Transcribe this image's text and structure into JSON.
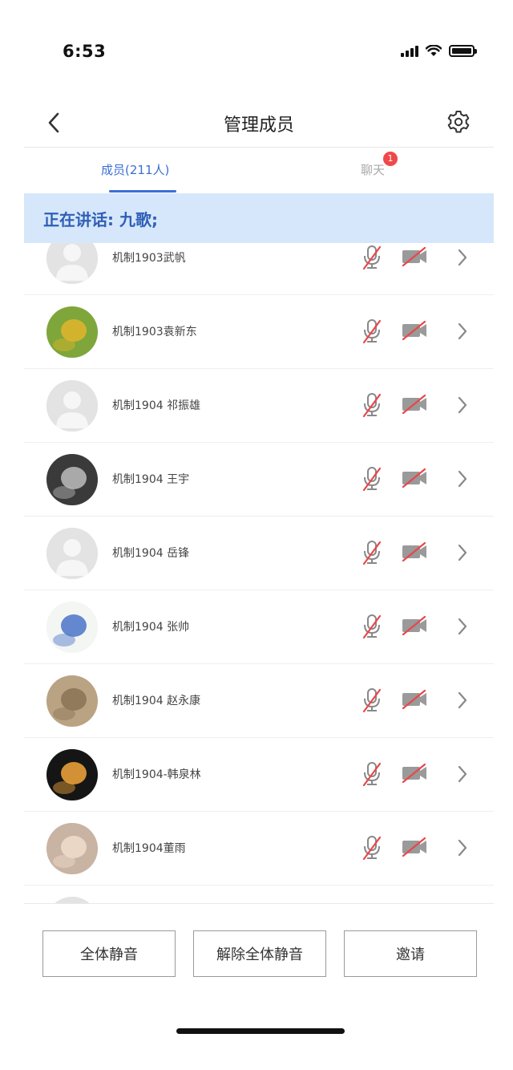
{
  "status_bar": {
    "time": "6:53"
  },
  "nav": {
    "title": "管理成员"
  },
  "tabs": {
    "members_label": "成员(211人)",
    "chat_label": "聊天",
    "chat_badge": "1"
  },
  "speaking": {
    "text": "正在讲话: 九歌;"
  },
  "members": [
    {
      "name": "机制1903武帆",
      "avatar": "default-avatar"
    },
    {
      "name": "机制1903袁新东",
      "avatar": "photo-avatar"
    },
    {
      "name": "机制1904  祁振雄",
      "avatar": "default-avatar"
    },
    {
      "name": "机制1904 王宇",
      "avatar": "photo-avatar"
    },
    {
      "name": "机制1904 岳锋",
      "avatar": "default-avatar"
    },
    {
      "name": "机制1904 张帅",
      "avatar": "photo-avatar"
    },
    {
      "name": "机制1904 赵永康",
      "avatar": "photo-avatar"
    },
    {
      "name": "机制1904-韩泉林",
      "avatar": "photo-avatar"
    },
    {
      "name": "机制1904董雨",
      "avatar": "photo-avatar"
    }
  ],
  "actions": {
    "mute_all": "全体静音",
    "unmute_all": "解除全体静音",
    "invite": "邀请"
  },
  "colors": {
    "accent": "#3b6fd4",
    "banner_bg": "#d6e7fb",
    "muted_red": "#e8474b",
    "badge_red": "#f04848"
  }
}
